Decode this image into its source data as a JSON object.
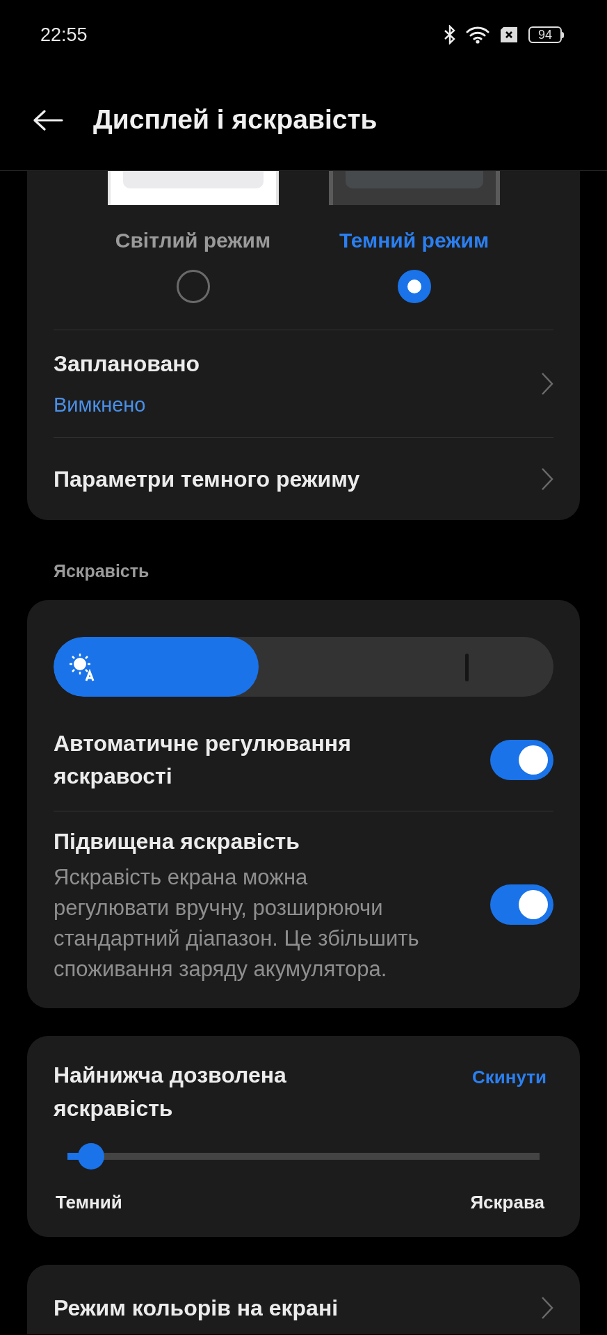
{
  "status_bar": {
    "time": "22:55",
    "battery": "94"
  },
  "header": {
    "title": "Дисплей і яскравість"
  },
  "theme_modes": [
    {
      "kind": "light",
      "label": "Світлий режим",
      "selected": false
    },
    {
      "kind": "dark",
      "label": "Темний режим",
      "selected": true
    }
  ],
  "dark_mode_rows": [
    {
      "title": "Заплановано",
      "value": "Вимкнено"
    },
    {
      "title": "Параметри темного режиму"
    }
  ],
  "brightness": {
    "heading": "Яскравість",
    "slider": {
      "level": 0.41
    },
    "toggles": [
      {
        "title": "Автоматичне регулювання яскравості",
        "on": true
      },
      {
        "title": "Підвищена яскравість",
        "description": "Яскравість екрана можна регулювати вручну, розширюючи стандартний діапазон. Це збільшить споживання заряду акумулятора.",
        "on": true
      }
    ]
  },
  "min_brightness": {
    "title": "Найнижча дозволена яскравість",
    "reset": "Скинути",
    "level": 0.05,
    "min_label": "Темний",
    "max_label": "Яскрава"
  },
  "color_mode_row": {
    "title": "Режим кольорів на екрані"
  }
}
